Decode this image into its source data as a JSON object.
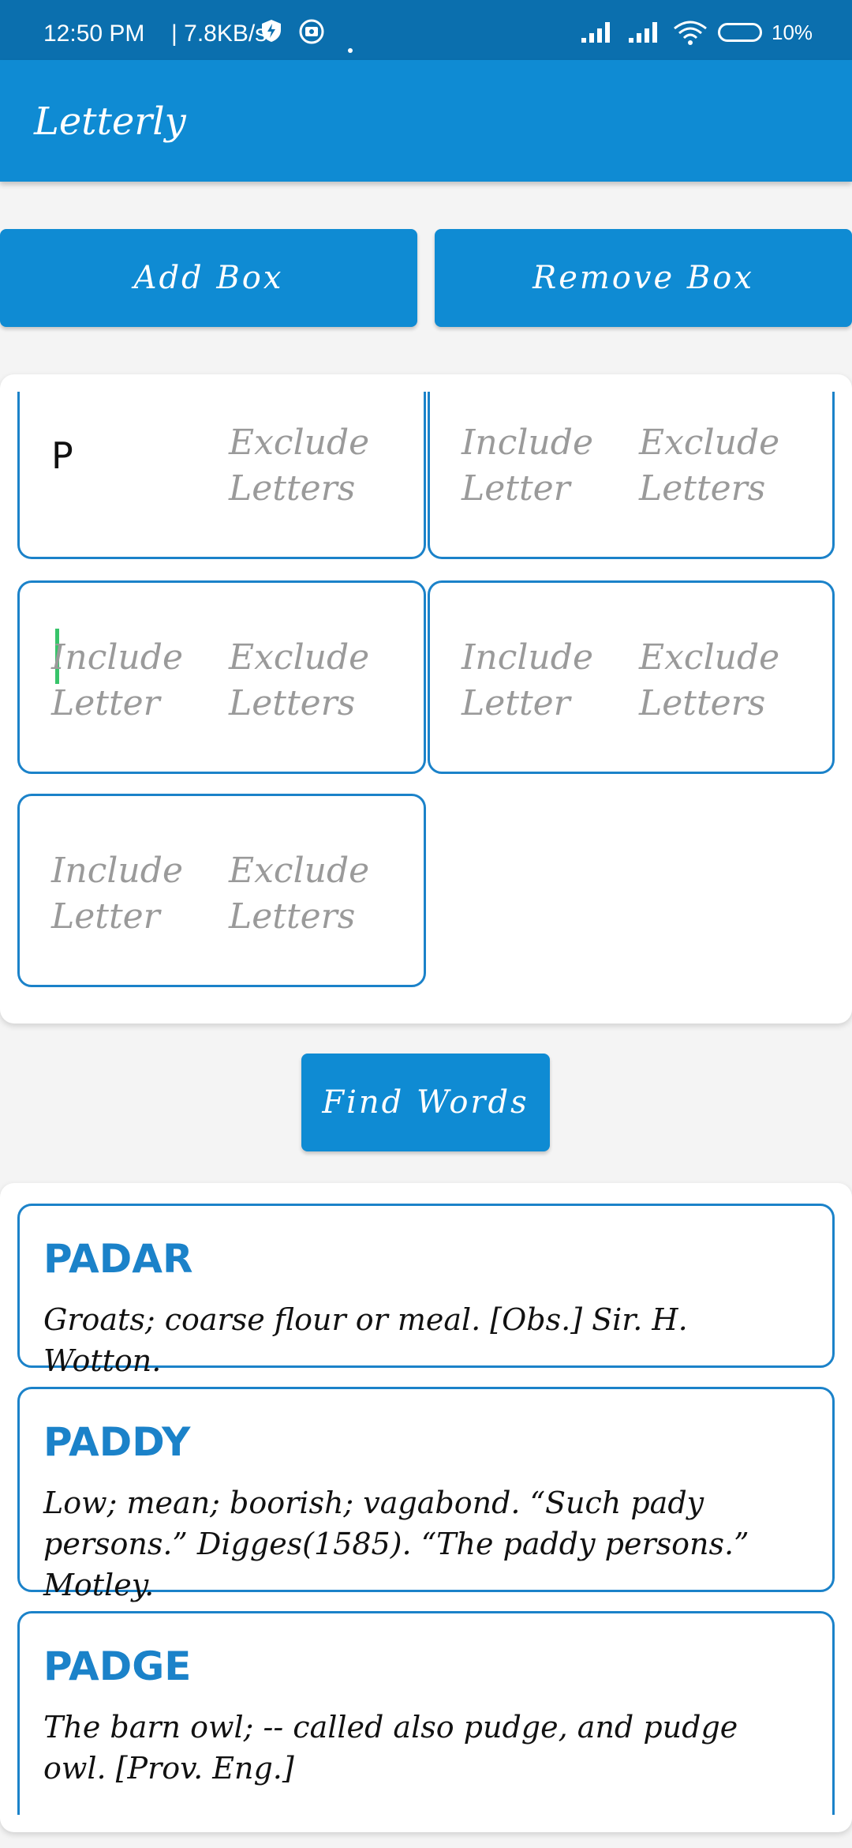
{
  "status": {
    "time": "12:50 PM",
    "speed": "| 7.8KB/s",
    "battery": "10%"
  },
  "app": {
    "title": "Letterly"
  },
  "actions": {
    "add_label": "Add Box",
    "remove_label": "Remove Box",
    "find_label": "Find Words"
  },
  "boxes": [
    {
      "include_value": "P",
      "include_placeholder": "Include Letter",
      "exclude_placeholder": "Exclude Letters"
    },
    {
      "include_placeholder": "Include Letter",
      "exclude_placeholder": "Exclude Letters"
    },
    {
      "include_placeholder": "Include Letter",
      "exclude_placeholder": "Exclude Letters"
    },
    {
      "include_placeholder": "Include Letter",
      "exclude_placeholder": "Exclude Letters"
    },
    {
      "include_placeholder": "Include Letter",
      "exclude_placeholder": "Exclude Letters"
    }
  ],
  "results": [
    {
      "word": "PADAR",
      "definition": "Groats; coarse flour or meal. [Obs.] Sir. H. Wotton."
    },
    {
      "word": "PADDY",
      "definition": "Low; mean; boorish; vagabond. “Such pady persons.” Digges(1585). “The paddy persons.” Motley."
    },
    {
      "word": "PADGE",
      "definition": "The barn owl; -- called also pudge, and pudge owl. [Prov. Eng.]"
    }
  ],
  "colors": {
    "primary": "#0f8bd3",
    "statusbar": "#0b6fae",
    "border": "#1b82c9",
    "cursor": "#38c46a"
  }
}
